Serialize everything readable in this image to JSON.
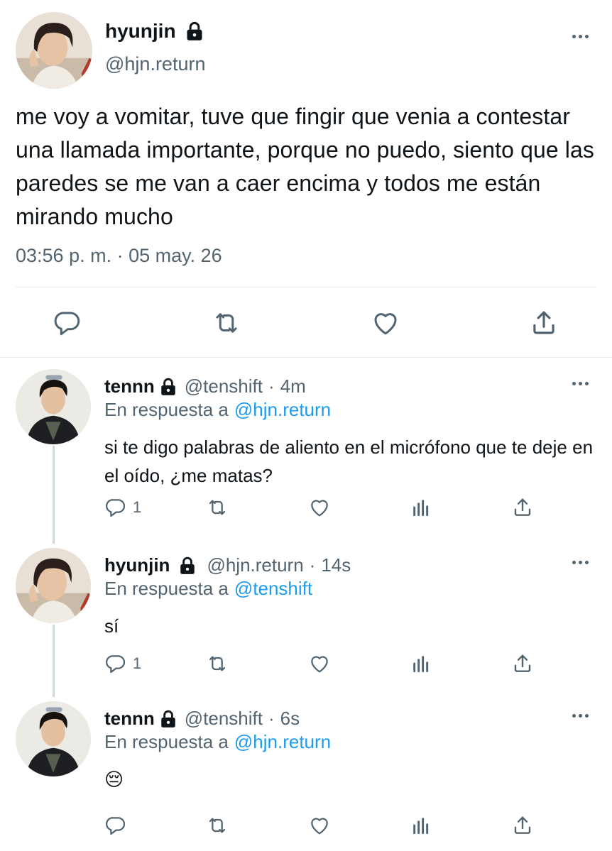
{
  "main": {
    "name": "hyunjin",
    "handle": "@hjn.return",
    "text": "me voy a vomitar, tuve que fingir que venia a contestar una llamada importante, porque no puedo, siento que las paredes se me van a caer encima y todos me están mirando mucho",
    "timestamp": "03:56 p. m. · 05 may. 26",
    "actions": [
      "reply-icon",
      "retweet-icon",
      "like-icon",
      "share-icon"
    ]
  },
  "replies": [
    {
      "name": "tennn",
      "handle": "@tenshift",
      "sep": "·",
      "time": "4m",
      "reply_prefix": "En respuesta a",
      "reply_to": "@hjn.return",
      "text": "si te digo palabras de aliento en el micrófono que te deje en el oído, ¿me matas?",
      "reply_count": "1"
    },
    {
      "name": "hyunjin",
      "handle": "@hjn.return",
      "sep": "·",
      "time": "14s",
      "reply_prefix": "En respuesta a",
      "reply_to": "@tenshift",
      "text": "sí",
      "reply_count": "1"
    },
    {
      "name": "tennn",
      "handle": "@tenshift",
      "sep": "·",
      "time": "6s",
      "reply_prefix": "En respuesta a",
      "reply_to": "@hjn.return",
      "text": "😔",
      "reply_count": ""
    }
  ],
  "colors": {
    "text": "#0f1419",
    "secondary": "#536471",
    "link": "#1d9bf0",
    "divider": "#e6ecf0",
    "thread": "#cfd9de"
  }
}
